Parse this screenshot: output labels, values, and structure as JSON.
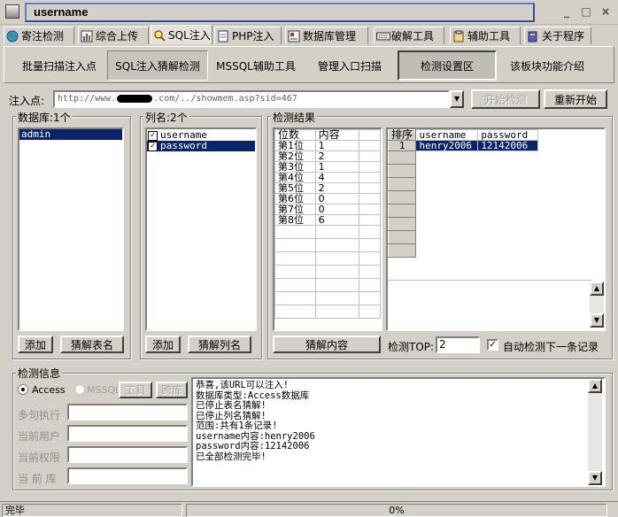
{
  "window": {
    "title": "username",
    "minimize": "_",
    "maximize": "□",
    "close": "×"
  },
  "tabs": [
    {
      "label": "寄注检测",
      "icon": "globe-icon"
    },
    {
      "label": "综合上传",
      "icon": "chart-icon"
    },
    {
      "label": "SQL注入",
      "icon": "magnifier-icon"
    },
    {
      "label": "PHP注入",
      "icon": "document-icon"
    },
    {
      "label": "数据库管理",
      "icon": "database-icon"
    },
    {
      "label": "破解工具",
      "icon": "keyboard-icon"
    },
    {
      "label": "辅助工具",
      "icon": "clipboard-icon"
    },
    {
      "label": "关于程序",
      "icon": "book-icon"
    }
  ],
  "subtabs": [
    "批量扫描注入点",
    "SQL注入猜解检测",
    "MSSQL辅助工具",
    "管理入口扫描",
    "检测设置区",
    "该板块功能介绍"
  ],
  "inject": {
    "label": "注入点:",
    "url_prefix": "http://www.",
    "url_suffix": ".com/../showmem.asp?sid=467",
    "start_button": "开始检测",
    "restart_button": "重新开始"
  },
  "database": {
    "title": "数据库:1个",
    "items": [
      "admin"
    ],
    "add_button": "添加",
    "guess_button": "猜解表名"
  },
  "columns": {
    "title": "列名:2个",
    "items": [
      "username",
      "password"
    ],
    "add_button": "添加",
    "guess_button": "猜解列名"
  },
  "results": {
    "title": "检测结果",
    "pos_header": "位数",
    "content_header": "内容",
    "positions": [
      {
        "pos": "第1位",
        "val": "1"
      },
      {
        "pos": "第2位",
        "val": "2"
      },
      {
        "pos": "第3位",
        "val": "1"
      },
      {
        "pos": "第4位",
        "val": "4"
      },
      {
        "pos": "第5位",
        "val": "2"
      },
      {
        "pos": "第6位",
        "val": "0"
      },
      {
        "pos": "第7位",
        "val": "0"
      },
      {
        "pos": "第8位",
        "val": "6"
      }
    ],
    "guess_content_button": "猜解内容",
    "record_headers": [
      "排序",
      "username",
      "password"
    ],
    "records": [
      {
        "idx": "1",
        "username": "henry2006",
        "password": "12142006"
      }
    ],
    "top_label": "检测TOP:",
    "top_value": "2",
    "auto_next_label": "自动检测下一条记录",
    "auto_next_checked": true
  },
  "info": {
    "title": "检测信息",
    "access_label": "Access",
    "mssql_label": "MSSQL",
    "tool_button": "工具",
    "cross_button": "跨库",
    "multi_label": "多句执行",
    "user_label": "当前用户",
    "perm_label": "当前权限",
    "db_label": "当 前 库",
    "log": [
      "恭喜,该URL可以注入!",
      "数据库类型:Access数据库",
      "已停止表名猜解!",
      "已停止列名猜解!",
      "范围:共有1条记录!",
      "username内容:henry2006",
      "password内容:12142006",
      "已全部检测完毕!"
    ]
  },
  "status": {
    "text": "完毕",
    "progress_text": "0%",
    "progress": 0
  }
}
